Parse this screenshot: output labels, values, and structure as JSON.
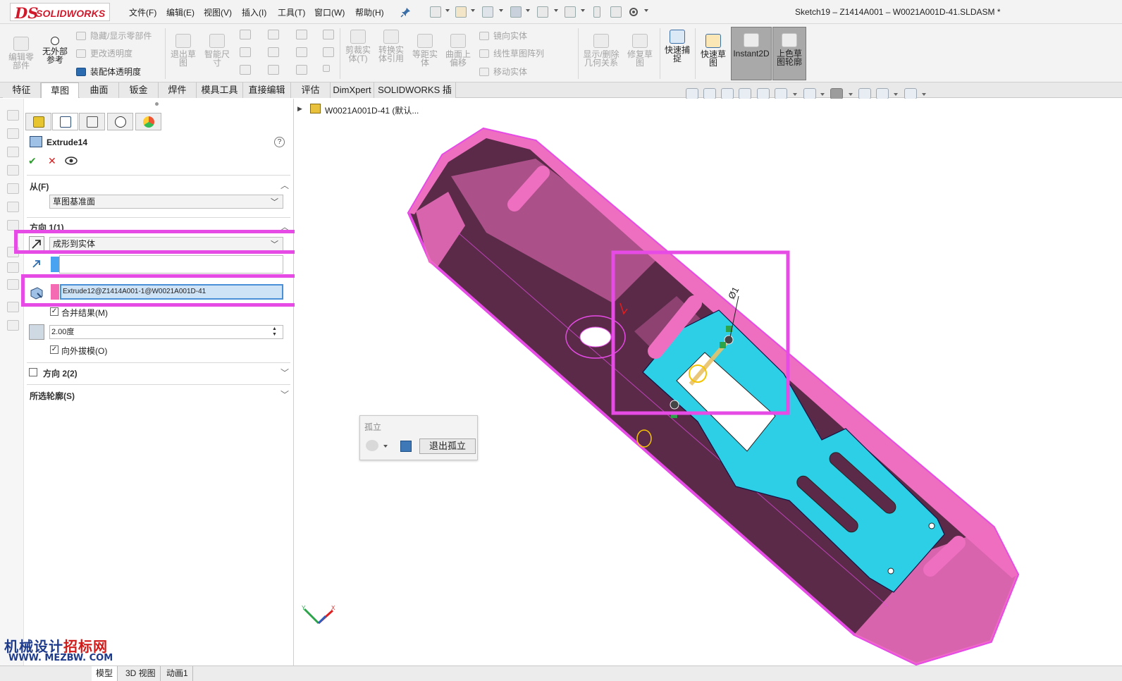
{
  "app": {
    "logo_text": "SOLIDWORKS",
    "doc_title": "Sketch19 – Z1414A001 – W0021A001D-41.SLDASM *"
  },
  "menu": [
    "文件(F)",
    "编辑(E)",
    "视图(V)",
    "插入(I)",
    "工具(T)",
    "窗口(W)",
    "帮助(H)"
  ],
  "commands": {
    "edit_part": "编辑零\n部件",
    "no_external_ref": "无外部\n参考",
    "hide_show_components": "隐藏/显示零部件",
    "change_transparency": "更改透明度",
    "assembly_transparency": "装配体透明度",
    "exit_sketch": "退出草\n图",
    "smart_dimension": "智能尺\n寸",
    "trim_entities": "剪裁实\n体(T)",
    "convert_entities": "转换实\n体引用",
    "offset_entities": "等距实\n体",
    "offset_on_surface": "曲面上\n偏移",
    "mirror_entities": "镜向实体",
    "linear_pattern": "线性草图阵列",
    "move_entities": "移动实体",
    "display_delete_relations": "显示/删除\n几何关系",
    "repair_sketch": "修复草\n图",
    "quick_snaps": "快速捕\n捉",
    "rapid_sketch": "快速草\n图",
    "instant2d": "Instant2D",
    "shaded_sketch_contours": "上色草\n图轮廓"
  },
  "tabs": [
    "特征",
    "草图",
    "曲面",
    "钣金",
    "焊件",
    "模具工具",
    "直接编辑",
    "评估",
    "DimXpert",
    "SOLIDWORKS 插件"
  ],
  "active_tab": "草图",
  "property_manager": {
    "feature_name": "Extrude14",
    "help_label": "?",
    "from": {
      "header": "从(F)",
      "start_condition": "草图基准面"
    },
    "direction1": {
      "header": "方向 1(1)",
      "end_condition": "成形到实体",
      "direction_value": "",
      "selected_body": "Extrude12@Z1414A001-1@W0021A001D-41",
      "merge_result_label": "合并结果(M)",
      "merge_result_checked": true,
      "draft_angle": "2.00度",
      "draft_outward_label": "向外拔模(O)",
      "draft_outward_checked": true
    },
    "direction2": {
      "header": "方向 2(2)",
      "checked": false
    },
    "selected_contours": {
      "header": "所选轮廓(S)"
    }
  },
  "feature_tree": {
    "root": "W0021A001D-41  (默认..."
  },
  "viewport": {
    "dimension_label": "Ø1",
    "isolate_title": "孤立",
    "exit_isolate": "退出孤立",
    "triad_x": "X",
    "triad_y": "Y"
  },
  "watermark": {
    "line1_prefix": "机械设计",
    "line1_suffix": "招标网",
    "line2": "WWW. MEZBW. COM"
  },
  "bottom_tabs": [
    "模型",
    "3D 视图",
    "动画1"
  ],
  "colors": {
    "highlight": "#e64be6",
    "body_pink": "#ee6fc0",
    "body_dark": "#5a2a48",
    "plate_cyan": "#2dcfe6",
    "selection_blue": "#3a6fa8"
  }
}
